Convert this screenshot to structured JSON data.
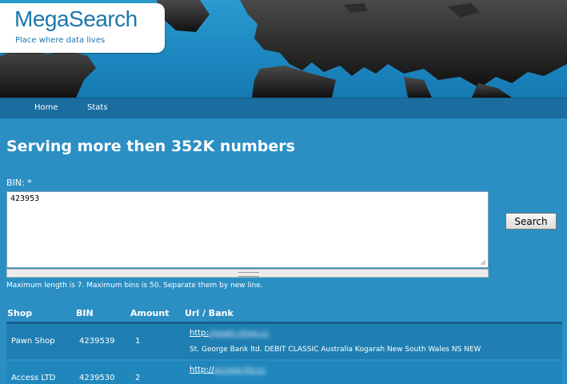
{
  "header": {
    "logo_title": "MegaSearch",
    "logo_subtitle": "Place where data lives"
  },
  "nav": {
    "items": [
      {
        "label": "Home"
      },
      {
        "label": "Stats"
      }
    ]
  },
  "main": {
    "title": "Serving more then 352K numbers",
    "bin_label": "BIN: *",
    "bin_value": "423953",
    "search_label": "Search",
    "helper": "Maximum length is 7. Maximum bins is 50. Separate them by new line."
  },
  "table": {
    "headers": [
      "Shop",
      "BIN",
      "Amount",
      "Url / Bank"
    ],
    "rows": [
      {
        "shop": "Pawn Shop",
        "bin": "4239539",
        "amount": "1",
        "url_prefix": "http:",
        "url_hidden": "//pawn-shop.cc",
        "bank": "St. George Bank ltd. DEBIT CLASSIC Australia Kogarah New South Wales NS NEW"
      },
      {
        "shop": "Access LTD",
        "bin": "4239530",
        "amount": "2",
        "url_prefix": "http://",
        "url_hidden": "access-ltd.cc",
        "bank": ""
      }
    ]
  },
  "colors": {
    "background": "#2b8fc4",
    "navbar": "#1b6d9f",
    "row": "#1f7fb3",
    "logo_text": "#1d77ad"
  }
}
